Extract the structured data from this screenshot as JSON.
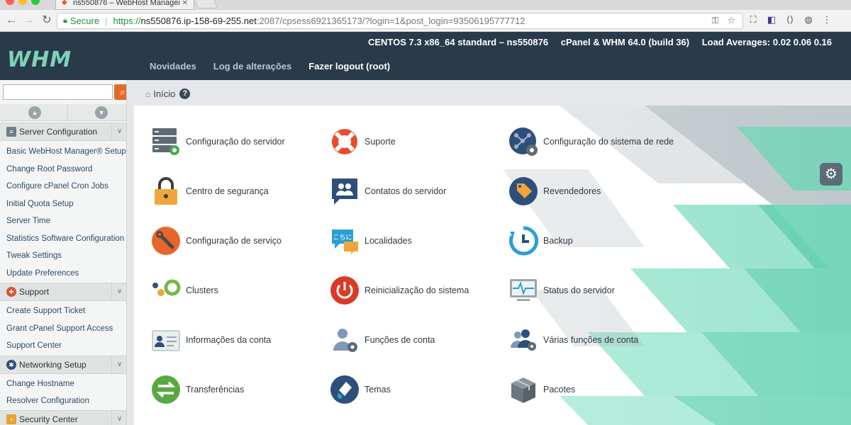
{
  "browser": {
    "tab_title": "ns550876 – WebHost Manager",
    "secure_label": "Secure",
    "url_scheme": "https://",
    "url_host": "ns550876.ip-158-69-255.net",
    "url_rest": ":2087/cpsess6921365173/?login=1&post_login=93506195777712"
  },
  "header": {
    "logo": "WHM",
    "os": "CENTOS 7.3 x86_64 standard – ns550876",
    "version": "cPanel & WHM 64.0 (build 36)",
    "load": "Load Averages: 0.02 0.06 0.16",
    "nav": [
      "Novidades",
      "Log de alterações",
      "Fazer logout (root)"
    ]
  },
  "sidebar": {
    "search_placeholder": "",
    "categories": [
      {
        "label": "Server Configuration",
        "items": [
          "Basic WebHost Manager® Setup",
          "Change Root Password",
          "Configure cPanel Cron Jobs",
          "Initial Quota Setup",
          "Server Time",
          "Statistics Software Configuration",
          "Tweak Settings",
          "Update Preferences"
        ]
      },
      {
        "label": "Support",
        "items": [
          "Create Support Ticket",
          "Grant cPanel Support Access",
          "Support Center"
        ]
      },
      {
        "label": "Networking Setup",
        "items": [
          "Change Hostname",
          "Resolver Configuration"
        ]
      },
      {
        "label": "Security Center",
        "items": []
      }
    ]
  },
  "breadcrumb": {
    "home": "Início"
  },
  "tiles": [
    {
      "label": "Configuração do servidor",
      "icon": "server-gear-icon"
    },
    {
      "label": "Suporte",
      "icon": "lifebuoy-icon"
    },
    {
      "label": "Configuração do sistema de rede",
      "icon": "network-wrench-icon"
    },
    {
      "label": "Centro de segurança",
      "icon": "padlock-icon"
    },
    {
      "label": "Contatos do servidor",
      "icon": "contacts-icon"
    },
    {
      "label": "Revendedores",
      "icon": "tag-icon"
    },
    {
      "label": "Configuração de serviço",
      "icon": "wrench-icon"
    },
    {
      "label": "Localidades",
      "icon": "speech-bubble-icon"
    },
    {
      "label": "Backup",
      "icon": "backup-clock-icon"
    },
    {
      "label": "Clusters",
      "icon": "clusters-icon"
    },
    {
      "label": "Reinicialização do sistema",
      "icon": "power-icon"
    },
    {
      "label": "Status do servidor",
      "icon": "monitor-pulse-icon"
    },
    {
      "label": "Informações da conta",
      "icon": "id-card-icon"
    },
    {
      "label": "Funções de conta",
      "icon": "user-gear-icon"
    },
    {
      "label": "Várias funções de conta",
      "icon": "users-gear-icon"
    },
    {
      "label": "Transferências",
      "icon": "transfer-arrows-icon"
    },
    {
      "label": "Temas",
      "icon": "paint-icon"
    },
    {
      "label": "Pacotes",
      "icon": "package-box-icon"
    }
  ],
  "colors": {
    "topbar": "#293a4a",
    "logo": "#7dd3b6",
    "accent": "#e36b2a",
    "teal": "#67d6b4"
  }
}
